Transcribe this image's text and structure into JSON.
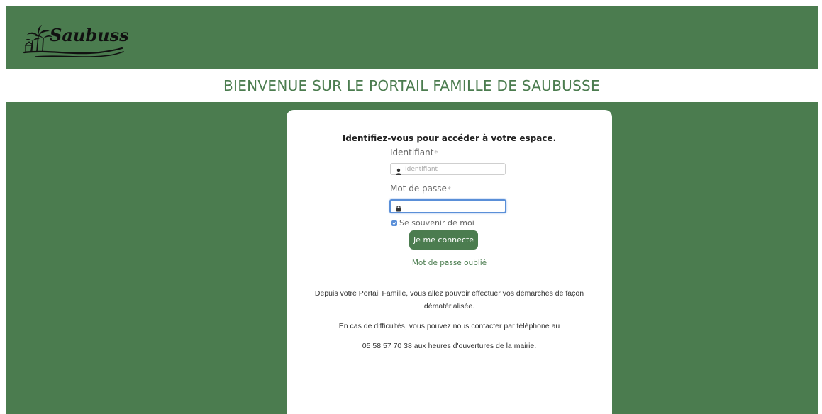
{
  "header": {
    "logo_text": "Saubusse",
    "logo_icon": "palm-tree-logo-icon"
  },
  "banner": {
    "title": "BIENVENUE SUR LE PORTAIL FAMILLE DE SAUBUSSE"
  },
  "login": {
    "heading": "Identifiez-vous pour accéder à votre espace.",
    "username_label": "Identifiant",
    "username_placeholder": "Identifiant",
    "username_value": "",
    "username_icon": "user-icon",
    "password_label": "Mot de passe",
    "password_placeholder": "",
    "password_value": "",
    "password_icon": "lock-icon",
    "required_marker": "*",
    "remember_label": "Se souvenir de moi",
    "remember_checked": true,
    "submit_label": "Je me connecte",
    "forgot_label": "Mot de passe oublié"
  },
  "info": {
    "line1": "Depuis votre Portail Famille, vous allez pouvoir effectuer vos démarches de façon dématérialisée.",
    "line2": "En cas de difficultés, vous pouvez nous contacter par téléphone au",
    "line3": "05 58 57 70 38 aux heures d'ouvertures de la mairie."
  },
  "colors": {
    "brand_green": "#4b7c4f",
    "focus_blue": "#5a8fd8"
  }
}
